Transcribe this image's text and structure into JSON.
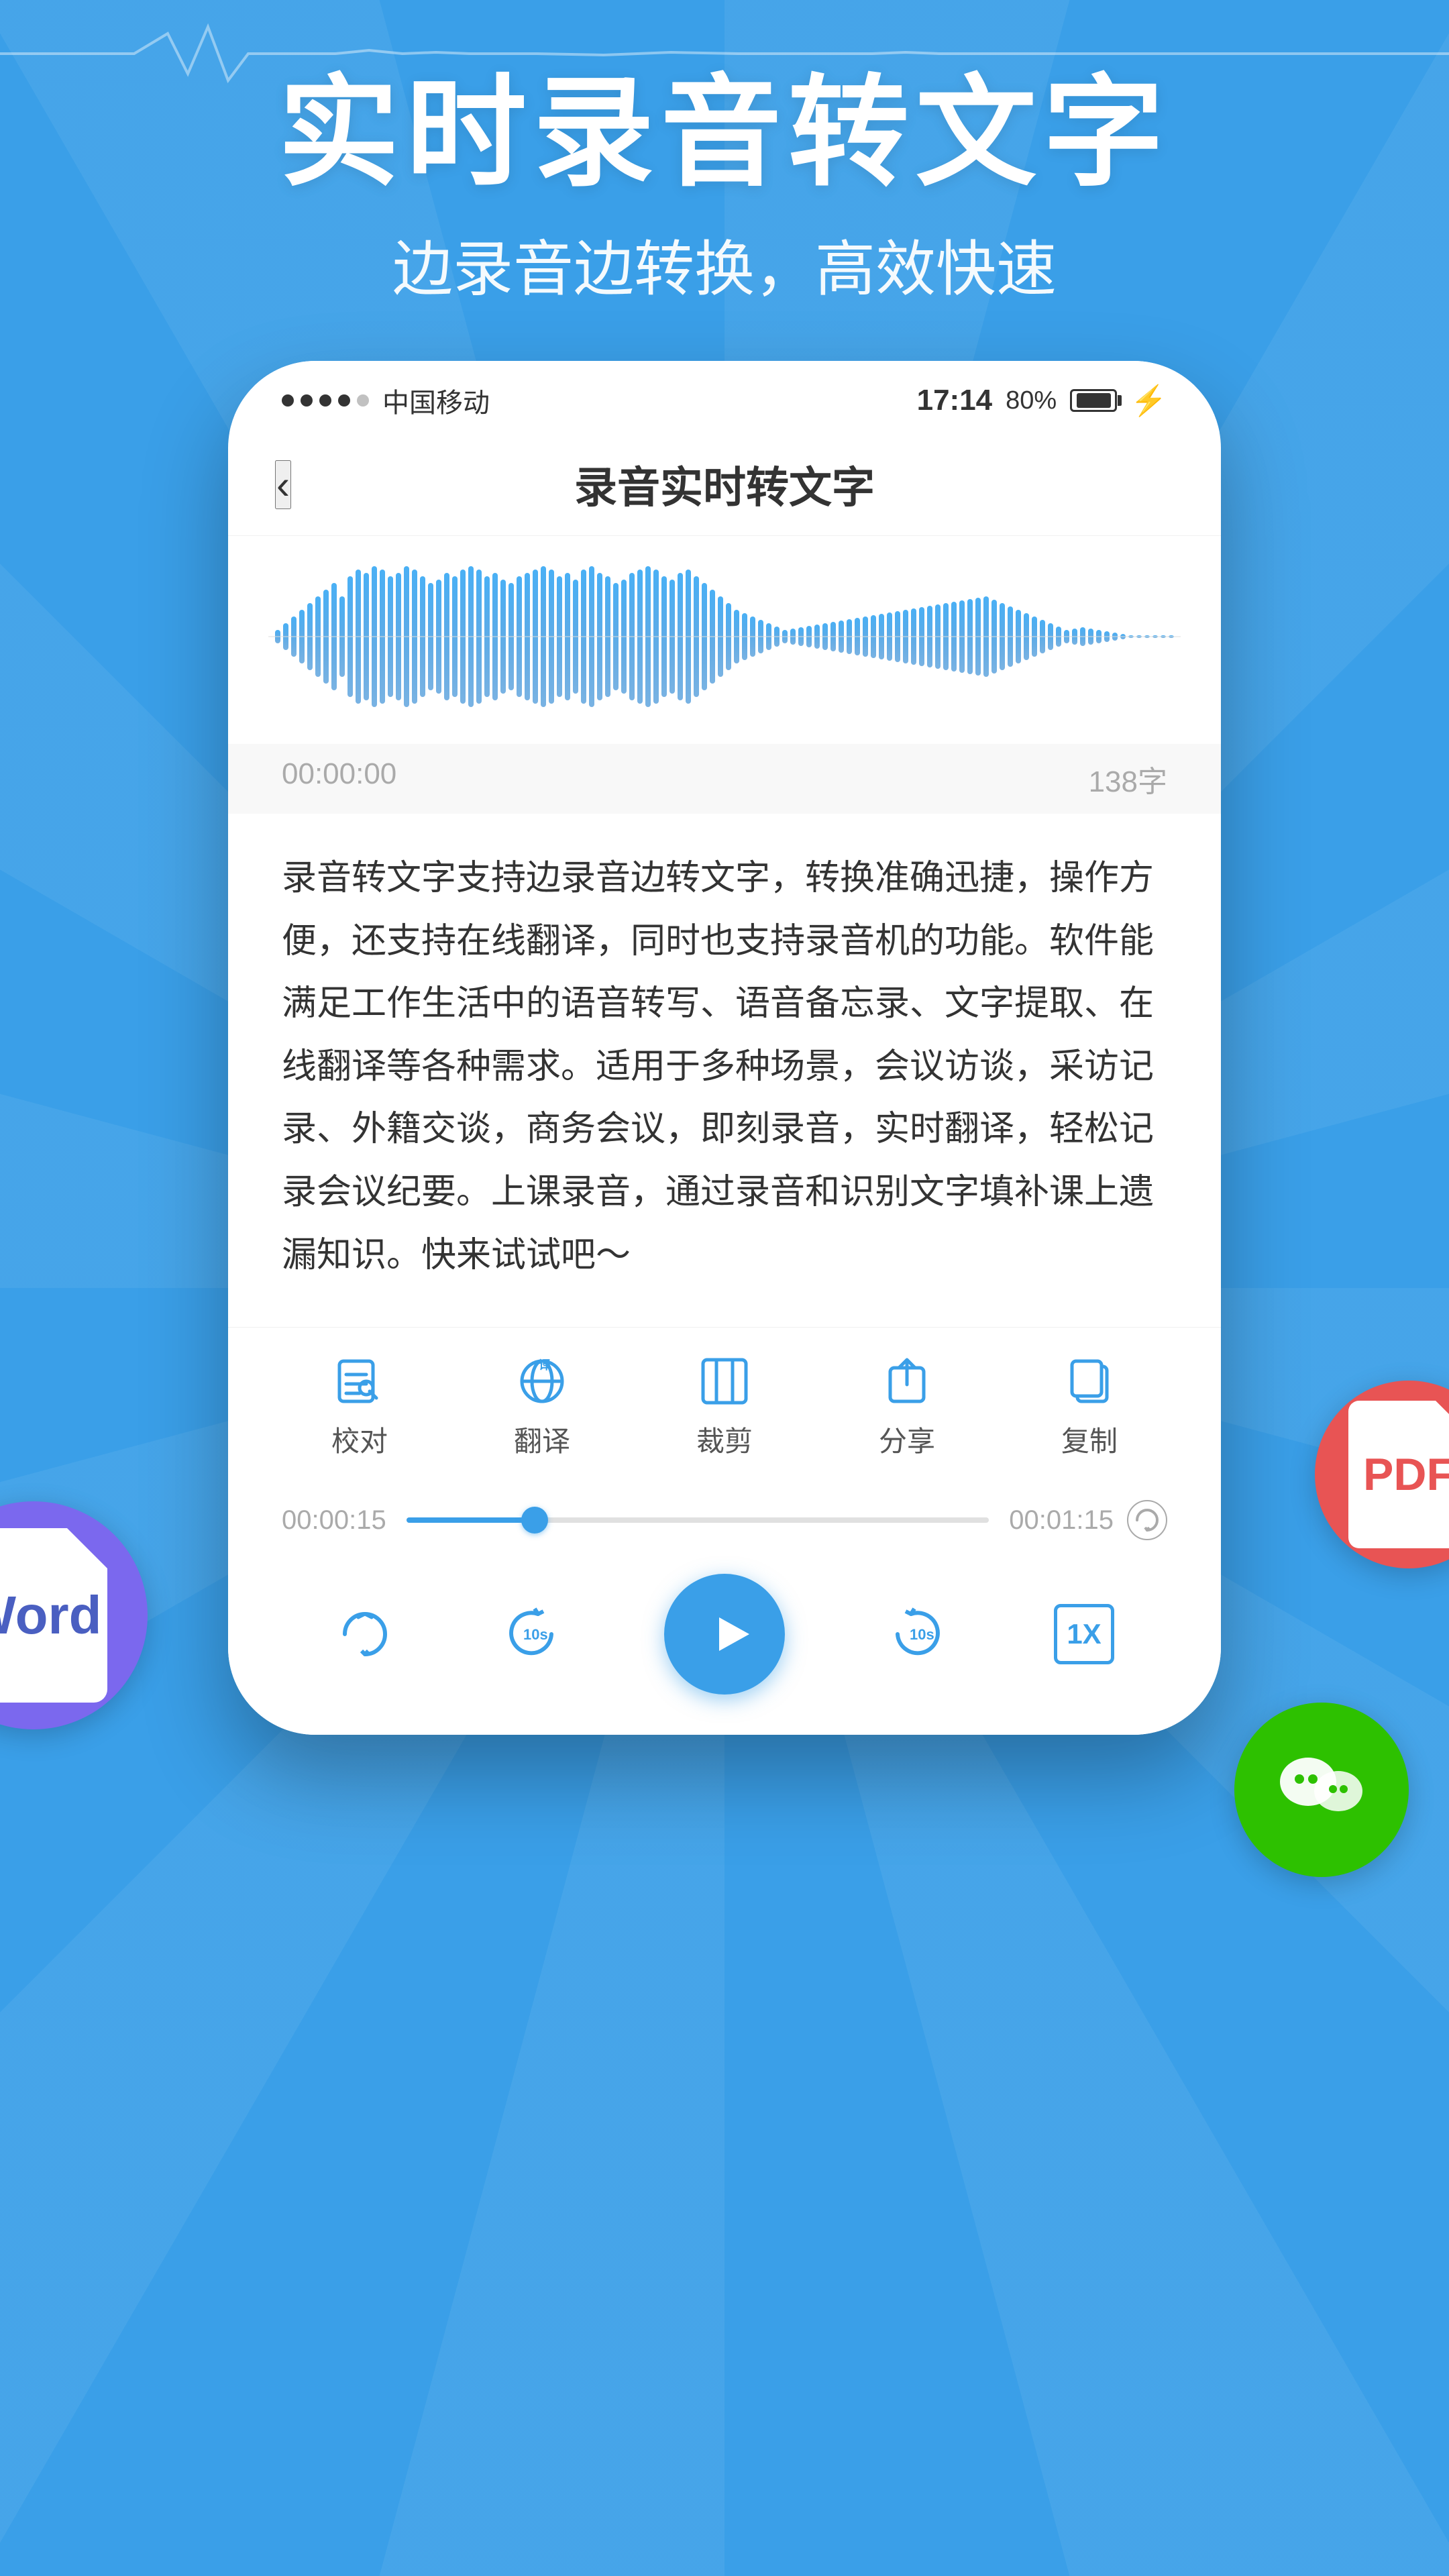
{
  "app": {
    "bg_color": "#3a9fe8",
    "main_title": "实时录音转文字",
    "subtitle": "边录音边转换，高效快速"
  },
  "status_bar": {
    "dots": 4,
    "carrier": "中国移动",
    "time": "17:14",
    "battery_percent": "80%"
  },
  "screen": {
    "title": "录音实时转文字",
    "back_label": "‹",
    "time_start": "00:00:00",
    "word_count": "138字",
    "transcript": "录音转文字支持边录音边转文字，转换准确迅捷，操作方便，还支持在线翻译，同时也支持录音机的功能。软件能满足工作生活中的语音转写、语音备忘录、文字提取、在线翻译等各种需求。适用于多种场景，会议访谈，采访记录、外籍交谈，商务会议，即刻录音，实时翻译，轻松记录会议纪要。上课录音，通过录音和识别文字填补课上遗漏知识。快来试试吧～"
  },
  "toolbar": {
    "items": [
      {
        "id": "proofread",
        "label": "校对"
      },
      {
        "id": "translate",
        "label": "翻译"
      },
      {
        "id": "trim",
        "label": "裁剪"
      },
      {
        "id": "share",
        "label": "分享"
      },
      {
        "id": "copy",
        "label": "复制"
      }
    ]
  },
  "progress": {
    "current_time": "00:00:15",
    "total_time": "00:01:15",
    "fill_percent": 22
  },
  "playback": {
    "speed_label": "1X",
    "forward_label": "10s",
    "backward_label": "10s"
  },
  "word_badge": {
    "text": "Word"
  },
  "pdf_badge": {
    "text": "PDF"
  },
  "wechat_badge": {
    "color": "#2dc100"
  }
}
